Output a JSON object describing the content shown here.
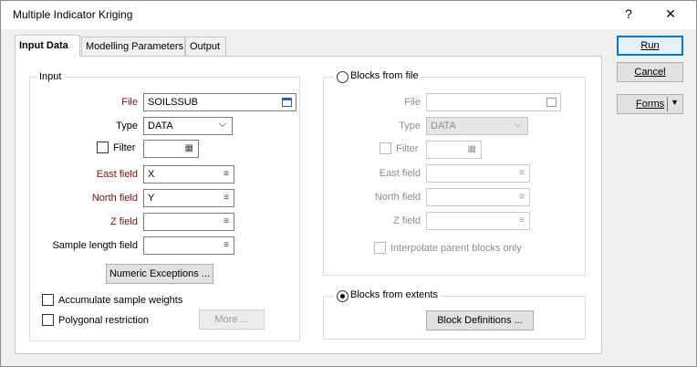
{
  "window": {
    "title": "Multiple Indicator Kriging",
    "help_label": "?",
    "close_label": "✕"
  },
  "tabs": [
    {
      "label": "Input Data",
      "active": true
    },
    {
      "label": "Modelling Parameters",
      "active": false
    },
    {
      "label": "Output",
      "active": false
    }
  ],
  "input_group": {
    "title": "Input",
    "file": {
      "label": "File",
      "value": "SOILSSUB"
    },
    "type": {
      "label": "Type",
      "value": "DATA"
    },
    "filter": {
      "label": "Filter",
      "checked": false,
      "value": ""
    },
    "east_field": {
      "label": "East field",
      "value": "X"
    },
    "north_field": {
      "label": "North field",
      "value": "Y"
    },
    "z_field": {
      "label": "Z field",
      "value": ""
    },
    "sample_length_field": {
      "label": "Sample length field",
      "value": ""
    },
    "numeric_exceptions_label": "Numeric Exceptions ...",
    "accumulate_sample_weights": {
      "label": "Accumulate sample weights",
      "checked": false
    },
    "polygonal_restriction": {
      "label": "Polygonal restriction",
      "checked": false
    },
    "more_label": "More ..."
  },
  "blocks_from_file": {
    "title": "Blocks from file",
    "selected": false,
    "file": {
      "label": "File",
      "value": ""
    },
    "type": {
      "label": "Type",
      "value": "DATA"
    },
    "filter": {
      "label": "Filter",
      "checked": false
    },
    "east_field": {
      "label": "East field",
      "value": ""
    },
    "north_field": {
      "label": "North field",
      "value": ""
    },
    "z_field": {
      "label": "Z field",
      "value": ""
    },
    "interpolate_parent": {
      "label": "Interpolate parent blocks only",
      "checked": false
    }
  },
  "blocks_from_extents": {
    "title": "Blocks from extents",
    "selected": true,
    "block_definitions_label": "Block Definitions ..."
  },
  "side_buttons": {
    "run_label": "Run",
    "cancel_label": "Cancel",
    "forms_label": "Forms",
    "forms_arrow": "▼"
  },
  "icons": {
    "list": "≡",
    "chevron": "⌵",
    "grid": "▦"
  },
  "colors": {
    "required_label": "#7a1010",
    "accent": "#0078d7"
  }
}
